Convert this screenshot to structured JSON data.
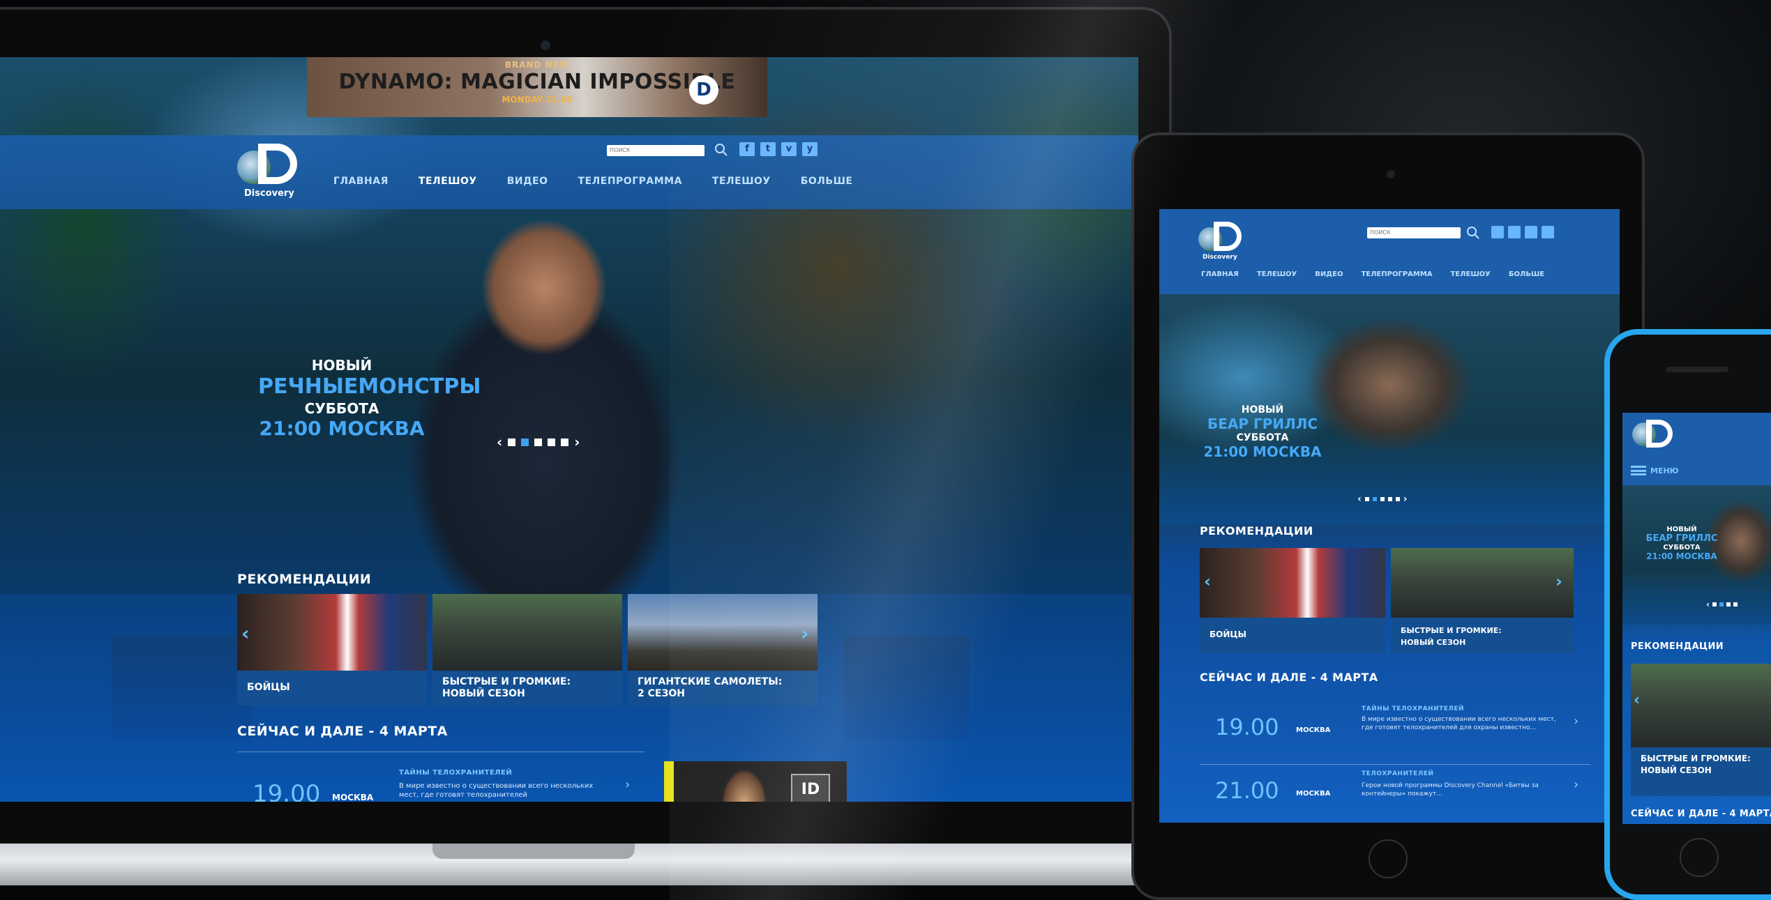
{
  "laptop": {
    "ad": {
      "small": "BRAND NEW",
      "title": "DYNAMO: MAGICIAN IMPOSSIBLE",
      "time": "MONDAY 21.00"
    },
    "search_placeholder": "ПОИСК",
    "nav": [
      "ГЛАВНАЯ",
      "ТЕЛЕШОУ",
      "ВИДЕО",
      "ТЕЛЕПРОГРАММА",
      "ТЕЛЕШОУ",
      "БОЛЬШЕ"
    ],
    "logo_text": "Discovery",
    "social": [
      "f",
      "t",
      "v",
      "y"
    ],
    "hero": {
      "line1": "НОВЫЙ",
      "line2": "РЕЧНЫЕМОНСТРЫ",
      "line3": "СУББОТА",
      "line4": "21:00 МОСКВА"
    },
    "recommendations_title": "РЕКОМЕНДАЦИИ",
    "cards": [
      {
        "caption": "БОЙЦЫ"
      },
      {
        "caption": "БЫСТРЫЕ И ГРОМКИЕ:\nНОВЫЙ СЕЗОН"
      },
      {
        "caption": "ГИГАНТСКИЕ САМОЛЕТЫ:\n2 СЕЗОН"
      }
    ],
    "schedule_title": "СЕЙЧАС И ДАЛЕ - 4 МАРТА",
    "schedule": [
      {
        "time": "19.00",
        "city": "МОСКВА",
        "show": "ТАЙНЫ ТЕЛОХРАНИТЕЛЕЙ",
        "desc": "В мире известно о существовании всего нескольких мест, где готовят телохранителей"
      }
    ],
    "id_badge": "ID"
  },
  "tablet": {
    "search_placeholder": "ПОИСК",
    "logo_text": "Discovery",
    "nav": [
      "ГЛАВНАЯ",
      "ТЕЛЕШОУ",
      "ВИДЕО",
      "ТЕЛЕПРОГРАММА",
      "ТЕЛЕШОУ",
      "БОЛЬШЕ"
    ],
    "hero": {
      "line1": "НОВЫЙ",
      "line2": "БЕАР ГРИЛЛС",
      "line3": "СУББОТА",
      "line4": "21:00 МОСКВА"
    },
    "recommendations_title": "РЕКОМЕНДАЦИИ",
    "cards": [
      {
        "caption": "БОЙЦЫ"
      },
      {
        "caption": "БЫСТРЫЕ И ГРОМКИЕ:\nНОВЫЙ СЕЗОН"
      }
    ],
    "schedule_title": "СЕЙЧАС И ДАЛЕ - 4 МАРТА",
    "schedule": [
      {
        "time": "19.00",
        "city": "МОСКВА",
        "show": "ТАЙНЫ ТЕЛОХРАНИТЕЛЕЙ",
        "desc": "В мире известно о существовании всего нескольких мест, где готовят телохранителей для охраны известно..."
      },
      {
        "time": "21.00",
        "city": "МОСКВА",
        "show": "ТЕЛОХРАНИТЕЛЕЙ",
        "desc": "Герои новой программы Discovery Channel «Битвы за контейнеры» покажут..."
      }
    ]
  },
  "phone": {
    "menu_label": "МЕНЮ",
    "hero": {
      "line1": "НОВЫЙ",
      "line2": "БЕАР ГРИЛЛС",
      "line3": "СУББОТА",
      "line4": "21:00 МОСКВА"
    },
    "recommendations_title": "РЕКОМЕНДАЦИИ",
    "card_caption": "БЫСТРЫЕ И ГРОМКИЕ:\nНОВЫЙ СЕЗОН",
    "schedule_title": "СЕЙЧАС И ДАЛЕ - 4 МАРТА"
  },
  "colors": {
    "accent": "#46a8f6",
    "header": "#1b5ea8",
    "phone_frame": "#27a6ee"
  }
}
